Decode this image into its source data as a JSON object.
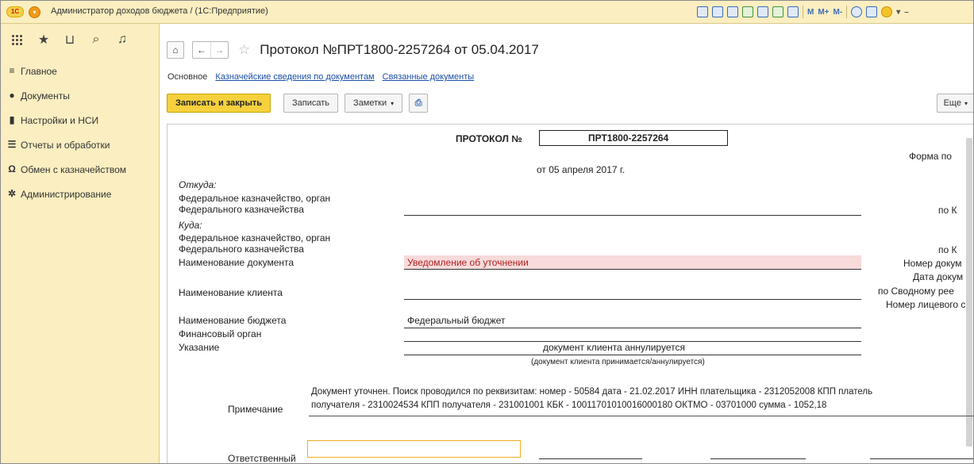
{
  "window": {
    "logo_text": "1С",
    "title": "Администратор доходов бюджета /  (1С:Предприятие)",
    "toolbar_m": "M",
    "toolbar_mplus": "M+",
    "toolbar_mminus": "M-"
  },
  "sidebar": {
    "items": [
      {
        "label": "Главное",
        "icon": "menu-lines-icon"
      },
      {
        "label": "Документы",
        "icon": "documents-icon"
      },
      {
        "label": "Настройки и НСИ",
        "icon": "settings-book-icon"
      },
      {
        "label": "Отчеты и обработки",
        "icon": "reports-icon"
      },
      {
        "label": "Обмен с казначейством",
        "icon": "omega-icon"
      },
      {
        "label": "Администрирование",
        "icon": "gear-icon"
      }
    ]
  },
  "document": {
    "title": "Протокол №ПРТ1800-2257264 от 05.04.2017",
    "tabs": [
      "Основное",
      "Казначейские сведения по документам",
      "Связанные документы"
    ],
    "buttons": {
      "save_close": "Записать и закрыть",
      "save": "Записать",
      "notes": "Заметки",
      "more": "Еще"
    }
  },
  "form": {
    "protocol_label": "ПРОТОКОЛ №",
    "protocol_number": "ПРТ1800-2257264",
    "date_line": "от 05 апреля 2017 г.",
    "form_label": "Форма по",
    "from_label": "Откуда:",
    "from_org_1": "Федеральное казначейство, орган",
    "from_org_2": "Федерального казначейства",
    "to_label": "Куда:",
    "to_org_1": "Федеральное казначейство, орган",
    "to_org_2": "Федерального казначейства",
    "okpo_1": "по К",
    "okpo_2": "по К",
    "doc_name_label": "Наименование документа",
    "doc_name_value": "Уведомление об уточнении",
    "doc_number_label": "Номер докум",
    "doc_date_label": "Дата докум",
    "client_label": "Наименование клиента",
    "svod_label": "по Сводному рее",
    "account_label": "Номер лицевого с",
    "budget_label": "Наименование бюджета",
    "budget_value": "Федеральный бюджет",
    "fin_org_label": "Финансовый орган",
    "instruction_label": "Указание",
    "instruction_value": "документ клиента аннулируется",
    "instruction_hint": "(документ клиента принимается/аннулируется)",
    "note_label": "Примечание",
    "note_line1": "Документ уточнен. Поиск проводился по реквизитам:  номер - 50584 дата - 21.02.2017 ИНН плательщика - 2312052008 КПП платель",
    "note_line2": "получателя - 2310024534 КПП получателя - 231001001 КБК - 10011701010016000180 ОКТМО - 03701000 сумма - 1052,18",
    "responsible_label": "Ответственный"
  }
}
